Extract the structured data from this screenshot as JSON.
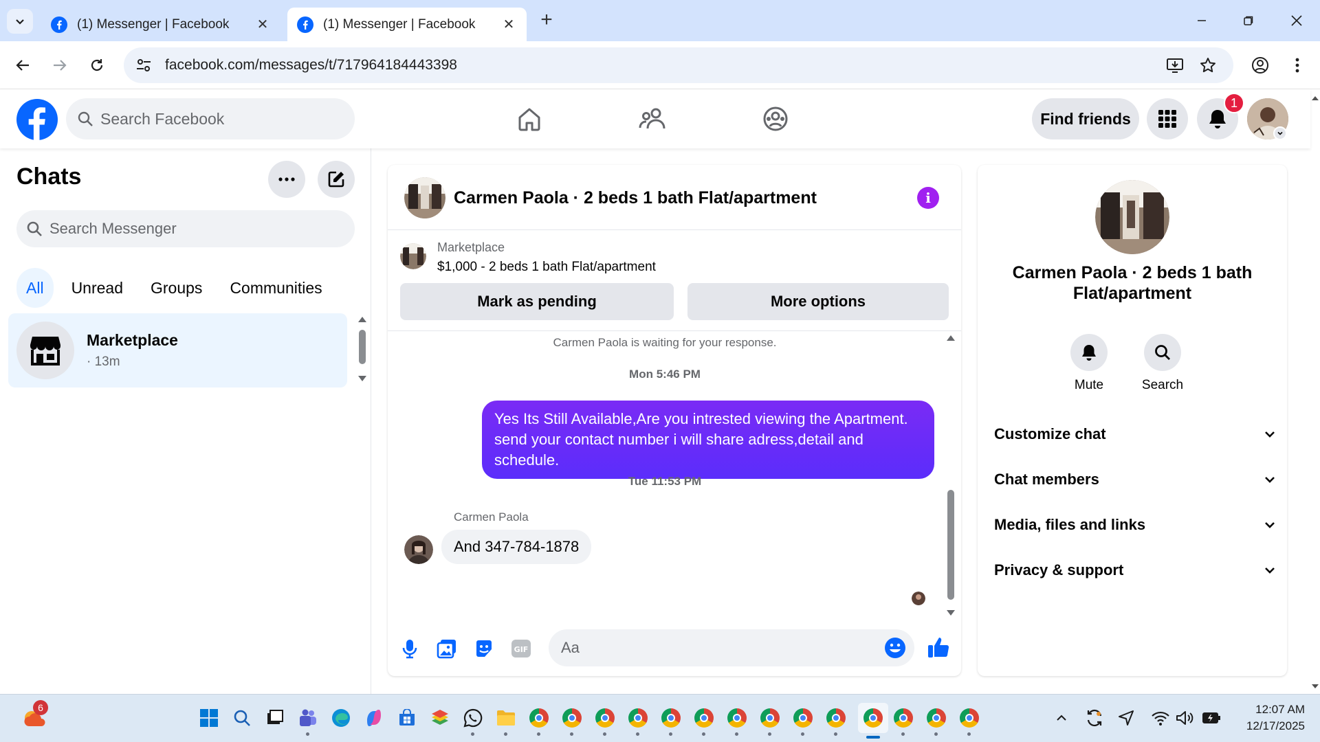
{
  "browser": {
    "tabs": [
      {
        "title": "(1) Messenger | Facebook",
        "active": false
      },
      {
        "title": "(1) Messenger | Facebook",
        "active": true
      }
    ],
    "url": "facebook.com/messages/t/717964184443398"
  },
  "header": {
    "search_placeholder": "Search Facebook",
    "find_friends_label": "Find friends",
    "notification_count": "1"
  },
  "sidebar": {
    "title": "Chats",
    "search_placeholder": "Search Messenger",
    "filters": [
      "All",
      "Unread",
      "Groups",
      "Communities"
    ],
    "active_filter": "All",
    "chats": [
      {
        "name": "Marketplace",
        "time": "· 13m",
        "icon": "storefront-icon"
      }
    ]
  },
  "conversation": {
    "title": "Carmen Paola · 2 beds 1 bath Flat/apartment",
    "listing": {
      "source": "Marketplace",
      "price_title": "$1,000 - 2 beds 1 bath Flat/apartment",
      "mark_pending_label": "Mark as pending",
      "more_options_label": "More options"
    },
    "waiting_note": "Carmen Paola is waiting for your response.",
    "messages": [
      {
        "timestamp": "Mon 5:46 PM",
        "direction": "outgoing",
        "text": "Yes Its Still Available,Are you intrested viewing the Apartment. send your contact number i will share adress,detail and schedule."
      },
      {
        "timestamp": "Tue 11:53 PM",
        "direction": "incoming",
        "sender": "Carmen Paola",
        "text": "And 347-784-1878"
      }
    ],
    "composer_placeholder": "Aa"
  },
  "details_panel": {
    "name": "Carmen Paola · 2 beds 1 bath Flat/apartment",
    "actions": [
      {
        "label": "Mute",
        "icon": "bell-icon"
      },
      {
        "label": "Search",
        "icon": "search-icon"
      }
    ],
    "sections": [
      "Customize chat",
      "Chat members",
      "Media, files and links",
      "Privacy & support"
    ]
  },
  "taskbar": {
    "weather_badge": "6",
    "time": "12:07 AM",
    "date": "12/17/2025"
  },
  "colors": {
    "facebook_blue": "#0866ff",
    "outgoing_bubble": "#6a2cf8",
    "info_purple": "#a020f0",
    "notification_red": "#e41e3f"
  }
}
